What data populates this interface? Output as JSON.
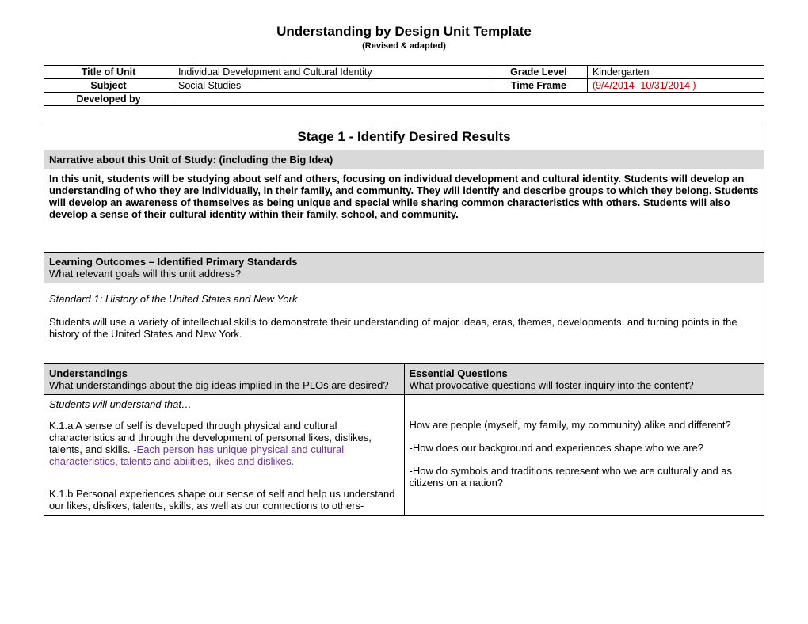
{
  "heading": {
    "title": "Understanding by Design Unit Template",
    "subtitle": "(Revised & adapted)"
  },
  "meta": {
    "title_label": "Title of Unit",
    "title_value": "Individual Development and Cultural Identity",
    "grade_label": "Grade Level",
    "grade_value": "Kindergarten",
    "subject_label": "Subject",
    "subject_value": "Social Studies",
    "time_label": "Time Frame",
    "time_value": "(9/4/2014- 10/31/2014 )",
    "developed_label": "Developed by",
    "developed_value": ""
  },
  "stage1": {
    "header": "Stage 1 - Identify Desired Results",
    "narrative_label": "Narrative about this Unit of Study: (including the Big Idea)",
    "narrative_body": "In this unit, students will be studying about self and others, focusing on individual development and cultural identity. Students will develop an understanding of who they are individually, in their family, and community. They will identify and describe groups to which they belong. Students will develop an awareness of themselves as being unique and special while sharing common characteristics with others. Students will also develop a sense of their cultural identity within their family, school, and community.",
    "learning_label": "Learning Outcomes – Identified Primary Standards",
    "learning_sub": "What relevant goals will this unit address?",
    "standard_title": "Standard 1: History of the United States and New York",
    "standard_body": "Students will use a variety of intellectual skills to demonstrate their understanding of major ideas, eras, themes, developments, and turning points in the history of the United States and New York.",
    "understandings_label": "Understandings",
    "understandings_sub": "What understandings about the big ideas implied in the PLOs are desired?",
    "essential_label": "Essential Questions",
    "essential_sub": "What provocative questions will foster inquiry into the content?",
    "students_will": "Students will understand that…",
    "k1a_lead": "K.1.a A sense of self is developed through physical and cultural characteristics and through the development of personal likes, dislikes, talents, and skills. ",
    "k1a_purple": "-Each person has unique physical and cultural characteristics, talents and abilities, likes and dislikes.",
    "k1b": "K.1.b Personal experiences shape our sense of self and help us understand our likes, dislikes, talents, skills, as well as our connections to others-",
    "eq1": "How are people (myself, my family, my community) alike and different?",
    "eq2": "-How does our background and experiences shape who we are?",
    "eq3": "-How do symbols and traditions represent who we are culturally and as citizens on a nation?"
  }
}
